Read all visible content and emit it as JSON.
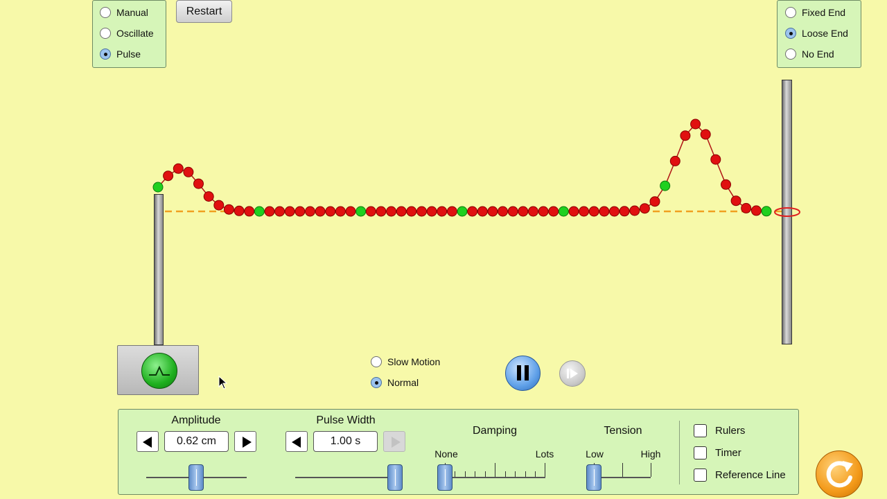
{
  "mode": {
    "options": [
      {
        "label": "Manual",
        "selected": false
      },
      {
        "label": "Oscillate",
        "selected": false
      },
      {
        "label": "Pulse",
        "selected": true
      }
    ]
  },
  "restart_label": "Restart",
  "end": {
    "options": [
      {
        "label": "Fixed End",
        "selected": false
      },
      {
        "label": "Loose End",
        "selected": true
      },
      {
        "label": "No End",
        "selected": false
      }
    ]
  },
  "speed": {
    "options": [
      {
        "label": "Slow Motion",
        "selected": false
      },
      {
        "label": "Normal",
        "selected": true
      }
    ]
  },
  "controls": {
    "amplitude": {
      "label": "Amplitude",
      "value": "0.62 cm"
    },
    "pulse_width": {
      "label": "Pulse Width",
      "value": "1.00 s"
    },
    "damping": {
      "label": "Damping",
      "min_label": "None",
      "max_label": "Lots"
    },
    "tension": {
      "label": "Tension",
      "min_label": "Low",
      "max_label": "High"
    },
    "checkboxes": [
      {
        "label": "Rulers",
        "checked": false
      },
      {
        "label": "Timer",
        "checked": false
      },
      {
        "label": "Reference Line",
        "checked": false
      }
    ]
  },
  "colors": {
    "background": "#f7f9a9",
    "panel": "#d6f5b8",
    "bead_red": "#e01010",
    "bead_green": "#1fd01f",
    "equilibrium_line": "#f0a020",
    "accent_blue": "#5fa0e8",
    "reset_orange": "#f39a1a"
  },
  "icons": {
    "pulse_generator": "pulse-shape-icon",
    "play_pause": "pause-icon",
    "step": "step-forward-icon",
    "reset": "reset-all-icon"
  }
}
